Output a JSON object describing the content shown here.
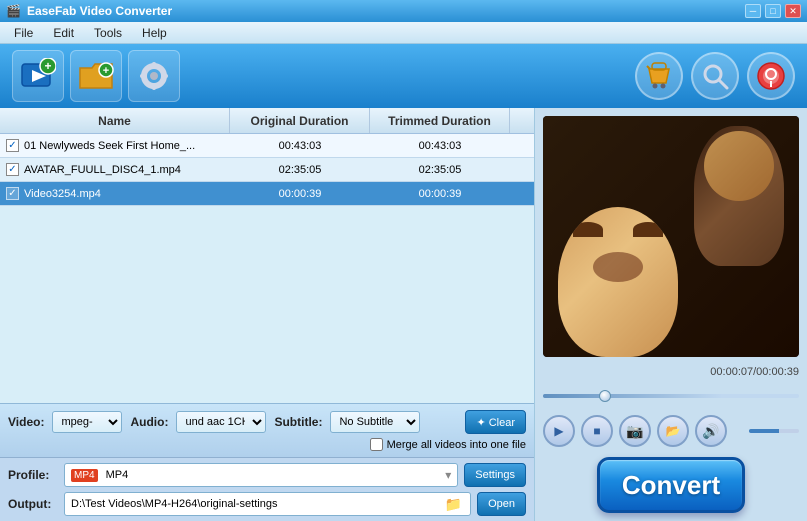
{
  "titleBar": {
    "title": "EaseFab Video Converter",
    "icon": "🎬",
    "minimizeLabel": "─",
    "maximizeLabel": "□",
    "closeLabel": "✕"
  },
  "menuBar": {
    "items": [
      "File",
      "Edit",
      "Tools",
      "Help"
    ]
  },
  "toolbar": {
    "addVideoTooltip": "Add Video",
    "addFolderTooltip": "Add Folder",
    "settingsTooltip": "Settings",
    "rightIcons": [
      "🛒",
      "🔍",
      "⊙"
    ]
  },
  "fileList": {
    "columns": [
      "Name",
      "Original Duration",
      "Trimmed Duration"
    ],
    "rows": [
      {
        "checked": true,
        "name": "01 Newlyweds Seek First Home_...",
        "originalDuration": "00:43:03",
        "trimmedDuration": "00:43:03",
        "selected": false
      },
      {
        "checked": true,
        "name": "AVATAR_FUULL_DISC4_1.mp4",
        "originalDuration": "02:35:05",
        "trimmedDuration": "02:35:05",
        "selected": false
      },
      {
        "checked": true,
        "name": "Video3254.mp4",
        "originalDuration": "00:00:39",
        "trimmedDuration": "00:00:39",
        "selected": true
      }
    ]
  },
  "videoControls": {
    "videoLabel": "Video:",
    "videoValue": "mpeg-",
    "audioLabel": "Audio:",
    "audioValue": "und aac 1CH",
    "subtitleLabel": "Subtitle:",
    "subtitleValue": "No Subtitle",
    "clearLabel": "✦ Clear",
    "mergeLabel": "Merge all videos into one file"
  },
  "profile": {
    "label": "Profile:",
    "value": "MP4",
    "settingsLabel": "Settings"
  },
  "output": {
    "label": "Output:",
    "path": "D:\\Test Videos\\MP4-H264\\original-settings",
    "openLabel": "Open"
  },
  "preview": {
    "timeDisplay": "00:00:07/00:00:39"
  },
  "convertBtn": {
    "label": "Convert"
  }
}
